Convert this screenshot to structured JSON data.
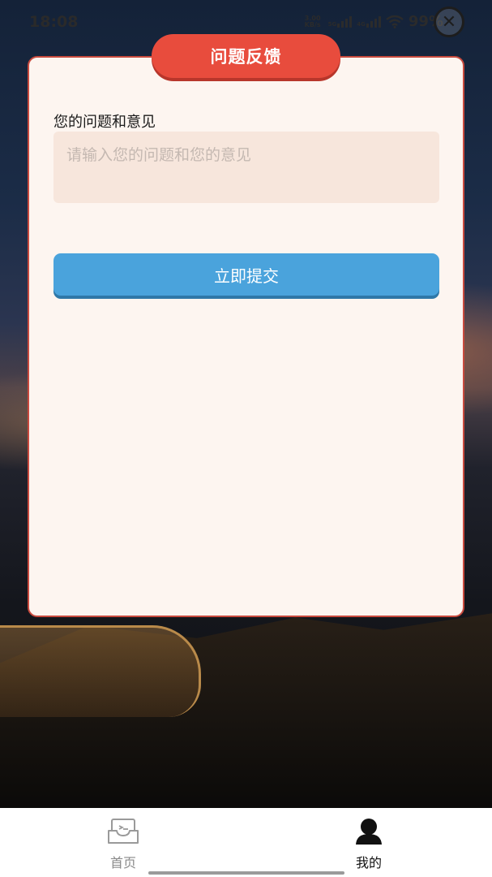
{
  "status_bar": {
    "time": "18:08",
    "net_speed_value": "3.00",
    "net_speed_unit": "KB/s",
    "sim1_type": "5G",
    "sim2_type": "4G",
    "battery": "99%"
  },
  "card": {
    "title": "问题反馈",
    "field_label": "您的问题和意见",
    "input_placeholder": "请输入您的问题和您的意见",
    "input_value": "",
    "submit_label": "立即提交"
  },
  "tab_bar": {
    "tabs": [
      {
        "label": "首页",
        "icon": "inbox-icon",
        "active": false
      },
      {
        "label": "我的",
        "icon": "user-icon",
        "active": true
      }
    ]
  },
  "colors": {
    "card_bg": "#fdf5f0",
    "card_border": "#c94a3e",
    "title_pill": "#e84c3d",
    "input_bg": "#f7e6dc",
    "submit_button": "#4aa3dc"
  }
}
